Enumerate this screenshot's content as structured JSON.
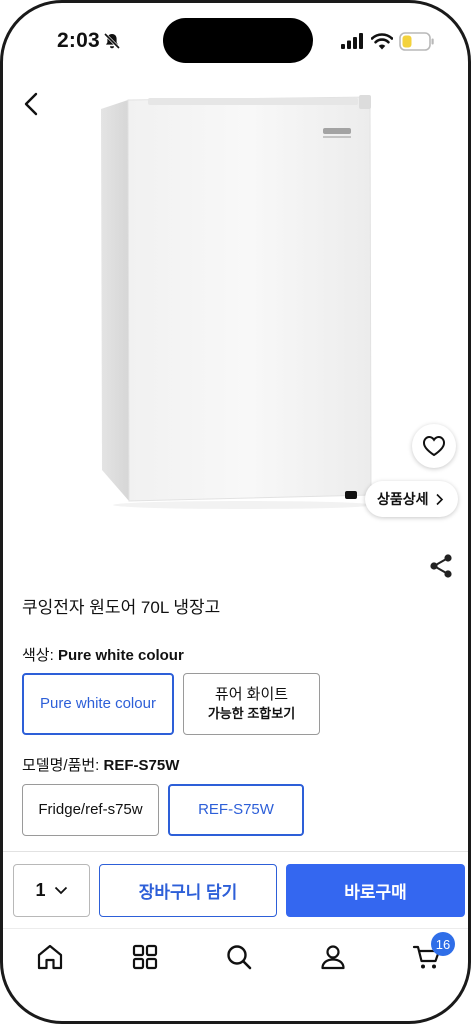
{
  "status_bar": {
    "time": "2:03"
  },
  "product": {
    "title": "쿠잉전자 원도어 70L 냉장고",
    "detail_button": "상품상세"
  },
  "color_option": {
    "label": "색상:",
    "selected": "Pure white colour",
    "choices": [
      {
        "line1": "Pure white colour",
        "line2": ""
      },
      {
        "line1": "퓨어 화이트",
        "line2": "가능한 조합보기"
      }
    ]
  },
  "model_option": {
    "label": "모델명/품번:",
    "selected": "REF-S75W",
    "choices": [
      "Fridge/ref-s75w",
      "REF-S75W"
    ]
  },
  "purchase": {
    "quantity": "1",
    "cart_label": "장바구니 담기",
    "buy_label": "바로구매"
  },
  "tab_bar": {
    "items": [
      "home-icon",
      "category-grid-icon",
      "search-icon",
      "user-icon",
      "cart-icon"
    ],
    "cart_badge": "16"
  },
  "colors": {
    "accent": "#3467f0",
    "accent_text": "#2d5fd8"
  }
}
